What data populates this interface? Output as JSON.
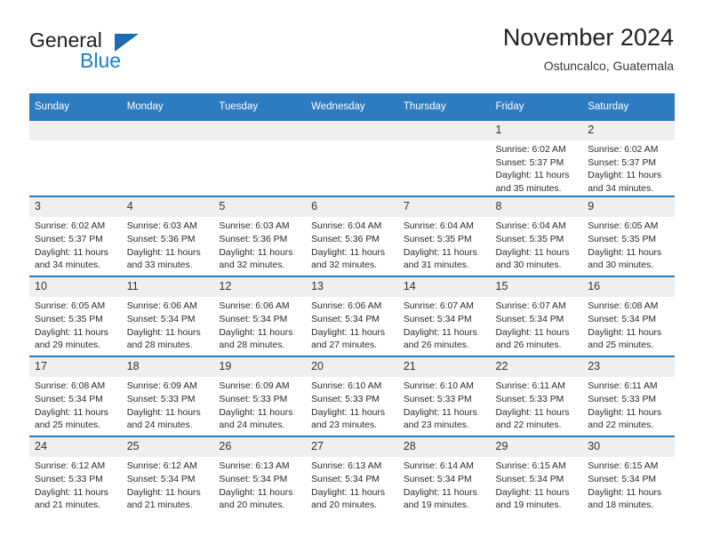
{
  "logo": {
    "word_dark": "General",
    "word_blue": "Blue",
    "triangle_color": "#1b6cb3",
    "blue_color": "#1b80d0"
  },
  "header": {
    "title": "November 2024",
    "subtitle": "Ostuncalco, Guatemala",
    "accent_color": "#2d7cc1"
  },
  "weekdays": [
    "Sunday",
    "Monday",
    "Tuesday",
    "Wednesday",
    "Thursday",
    "Friday",
    "Saturday"
  ],
  "labels": {
    "sunrise_prefix": "Sunrise:",
    "sunset_prefix": "Sunset:",
    "daylight_prefix": "Daylight:"
  },
  "weeks": [
    [
      {
        "day": "",
        "sunrise": "",
        "sunset": "",
        "daylight": ""
      },
      {
        "day": "",
        "sunrise": "",
        "sunset": "",
        "daylight": ""
      },
      {
        "day": "",
        "sunrise": "",
        "sunset": "",
        "daylight": ""
      },
      {
        "day": "",
        "sunrise": "",
        "sunset": "",
        "daylight": ""
      },
      {
        "day": "",
        "sunrise": "",
        "sunset": "",
        "daylight": ""
      },
      {
        "day": "1",
        "sunrise": "Sunrise: 6:02 AM",
        "sunset": "Sunset: 5:37 PM",
        "daylight": "Daylight: 11 hours and 35 minutes."
      },
      {
        "day": "2",
        "sunrise": "Sunrise: 6:02 AM",
        "sunset": "Sunset: 5:37 PM",
        "daylight": "Daylight: 11 hours and 34 minutes."
      }
    ],
    [
      {
        "day": "3",
        "sunrise": "Sunrise: 6:02 AM",
        "sunset": "Sunset: 5:37 PM",
        "daylight": "Daylight: 11 hours and 34 minutes."
      },
      {
        "day": "4",
        "sunrise": "Sunrise: 6:03 AM",
        "sunset": "Sunset: 5:36 PM",
        "daylight": "Daylight: 11 hours and 33 minutes."
      },
      {
        "day": "5",
        "sunrise": "Sunrise: 6:03 AM",
        "sunset": "Sunset: 5:36 PM",
        "daylight": "Daylight: 11 hours and 32 minutes."
      },
      {
        "day": "6",
        "sunrise": "Sunrise: 6:04 AM",
        "sunset": "Sunset: 5:36 PM",
        "daylight": "Daylight: 11 hours and 32 minutes."
      },
      {
        "day": "7",
        "sunrise": "Sunrise: 6:04 AM",
        "sunset": "Sunset: 5:35 PM",
        "daylight": "Daylight: 11 hours and 31 minutes."
      },
      {
        "day": "8",
        "sunrise": "Sunrise: 6:04 AM",
        "sunset": "Sunset: 5:35 PM",
        "daylight": "Daylight: 11 hours and 30 minutes."
      },
      {
        "day": "9",
        "sunrise": "Sunrise: 6:05 AM",
        "sunset": "Sunset: 5:35 PM",
        "daylight": "Daylight: 11 hours and 30 minutes."
      }
    ],
    [
      {
        "day": "10",
        "sunrise": "Sunrise: 6:05 AM",
        "sunset": "Sunset: 5:35 PM",
        "daylight": "Daylight: 11 hours and 29 minutes."
      },
      {
        "day": "11",
        "sunrise": "Sunrise: 6:06 AM",
        "sunset": "Sunset: 5:34 PM",
        "daylight": "Daylight: 11 hours and 28 minutes."
      },
      {
        "day": "12",
        "sunrise": "Sunrise: 6:06 AM",
        "sunset": "Sunset: 5:34 PM",
        "daylight": "Daylight: 11 hours and 28 minutes."
      },
      {
        "day": "13",
        "sunrise": "Sunrise: 6:06 AM",
        "sunset": "Sunset: 5:34 PM",
        "daylight": "Daylight: 11 hours and 27 minutes."
      },
      {
        "day": "14",
        "sunrise": "Sunrise: 6:07 AM",
        "sunset": "Sunset: 5:34 PM",
        "daylight": "Daylight: 11 hours and 26 minutes."
      },
      {
        "day": "15",
        "sunrise": "Sunrise: 6:07 AM",
        "sunset": "Sunset: 5:34 PM",
        "daylight": "Daylight: 11 hours and 26 minutes."
      },
      {
        "day": "16",
        "sunrise": "Sunrise: 6:08 AM",
        "sunset": "Sunset: 5:34 PM",
        "daylight": "Daylight: 11 hours and 25 minutes."
      }
    ],
    [
      {
        "day": "17",
        "sunrise": "Sunrise: 6:08 AM",
        "sunset": "Sunset: 5:34 PM",
        "daylight": "Daylight: 11 hours and 25 minutes."
      },
      {
        "day": "18",
        "sunrise": "Sunrise: 6:09 AM",
        "sunset": "Sunset: 5:33 PM",
        "daylight": "Daylight: 11 hours and 24 minutes."
      },
      {
        "day": "19",
        "sunrise": "Sunrise: 6:09 AM",
        "sunset": "Sunset: 5:33 PM",
        "daylight": "Daylight: 11 hours and 24 minutes."
      },
      {
        "day": "20",
        "sunrise": "Sunrise: 6:10 AM",
        "sunset": "Sunset: 5:33 PM",
        "daylight": "Daylight: 11 hours and 23 minutes."
      },
      {
        "day": "21",
        "sunrise": "Sunrise: 6:10 AM",
        "sunset": "Sunset: 5:33 PM",
        "daylight": "Daylight: 11 hours and 23 minutes."
      },
      {
        "day": "22",
        "sunrise": "Sunrise: 6:11 AM",
        "sunset": "Sunset: 5:33 PM",
        "daylight": "Daylight: 11 hours and 22 minutes."
      },
      {
        "day": "23",
        "sunrise": "Sunrise: 6:11 AM",
        "sunset": "Sunset: 5:33 PM",
        "daylight": "Daylight: 11 hours and 22 minutes."
      }
    ],
    [
      {
        "day": "24",
        "sunrise": "Sunrise: 6:12 AM",
        "sunset": "Sunset: 5:33 PM",
        "daylight": "Daylight: 11 hours and 21 minutes."
      },
      {
        "day": "25",
        "sunrise": "Sunrise: 6:12 AM",
        "sunset": "Sunset: 5:34 PM",
        "daylight": "Daylight: 11 hours and 21 minutes."
      },
      {
        "day": "26",
        "sunrise": "Sunrise: 6:13 AM",
        "sunset": "Sunset: 5:34 PM",
        "daylight": "Daylight: 11 hours and 20 minutes."
      },
      {
        "day": "27",
        "sunrise": "Sunrise: 6:13 AM",
        "sunset": "Sunset: 5:34 PM",
        "daylight": "Daylight: 11 hours and 20 minutes."
      },
      {
        "day": "28",
        "sunrise": "Sunrise: 6:14 AM",
        "sunset": "Sunset: 5:34 PM",
        "daylight": "Daylight: 11 hours and 19 minutes."
      },
      {
        "day": "29",
        "sunrise": "Sunrise: 6:15 AM",
        "sunset": "Sunset: 5:34 PM",
        "daylight": "Daylight: 11 hours and 19 minutes."
      },
      {
        "day": "30",
        "sunrise": "Sunrise: 6:15 AM",
        "sunset": "Sunset: 5:34 PM",
        "daylight": "Daylight: 11 hours and 18 minutes."
      }
    ]
  ]
}
